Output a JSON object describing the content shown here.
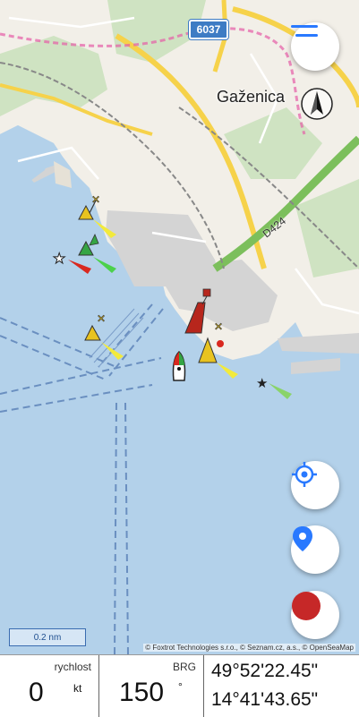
{
  "map": {
    "town_label": "Gaženica",
    "road_number": "6037",
    "road_label": "D424",
    "scale_label": "0.2 nm",
    "attribution": "© Foxtrot Technologies s.r.o., © Seznam.cz, a.s., © OpenSeaMap",
    "colors": {
      "sea": "#b3d1ea",
      "land": "#f2efe8",
      "accent": "#2979ff",
      "record": "#c62828"
    }
  },
  "buttons": {
    "menu_icon": "menu-icon",
    "compass_icon": "compass-north-icon",
    "locate_icon": "crosshair-icon",
    "marker_icon": "location-pin-icon",
    "record_icon": "record-icon"
  },
  "panel": {
    "speed_label": "rychlost",
    "speed_value": "0",
    "speed_unit": "kt",
    "bearing_label": "BRG",
    "bearing_value": "150",
    "bearing_unit": "°",
    "latitude": "49°52'22.45\"",
    "longitude": "14°41'43.65\""
  }
}
